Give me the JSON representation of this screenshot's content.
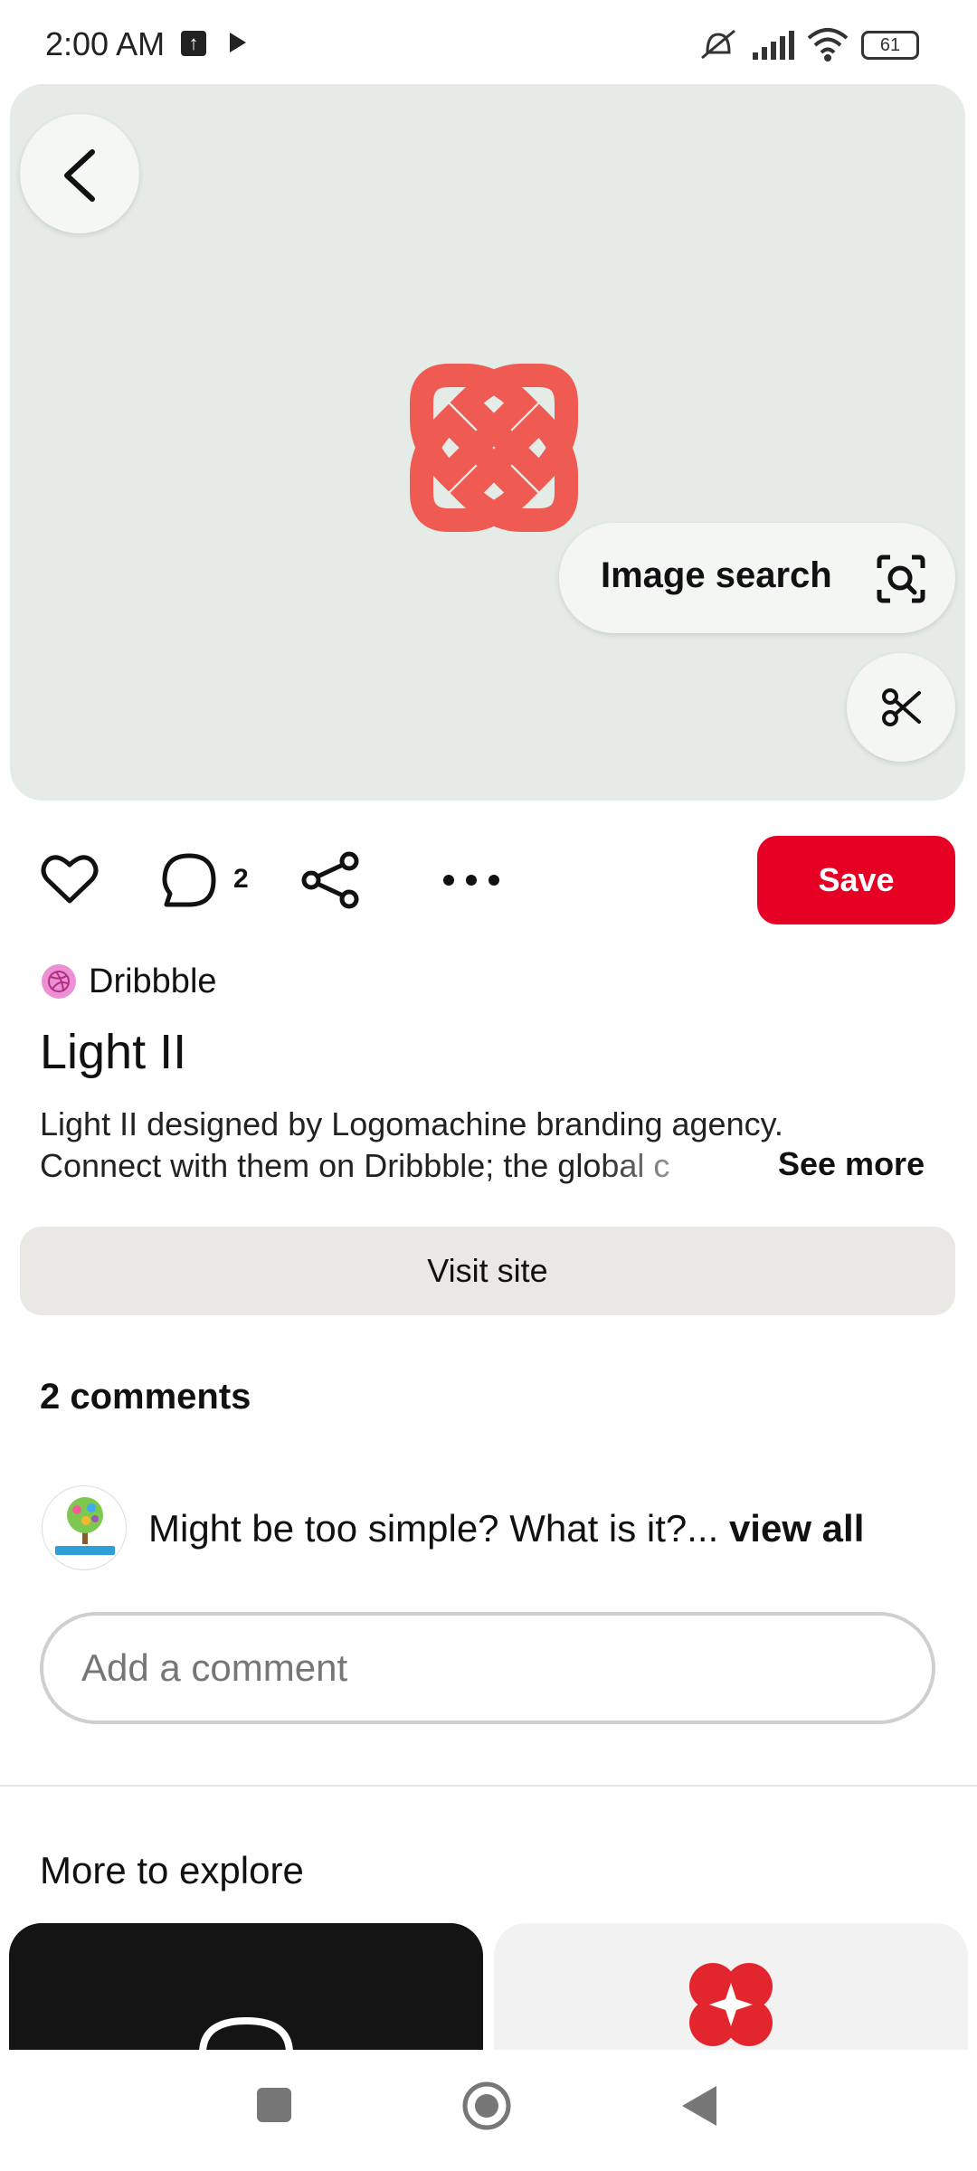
{
  "status_bar": {
    "time": "2:00 AM",
    "battery": "61"
  },
  "pin": {
    "image_search_label": "Image search",
    "comment_count": "2",
    "save_label": "Save",
    "source": "Dribbble",
    "title": "Light II",
    "description_line1": "Light II designed by Logomachine branding agency.",
    "description_line2": "Connect with them on Dribbble; the global c",
    "see_more_label": "See more",
    "visit_site_label": "Visit site"
  },
  "comments": {
    "heading": "2 comments",
    "preview_text": "Might be too simple?  What is it?...",
    "view_all_label": "view all",
    "input_placeholder": "Add a comment"
  },
  "explore": {
    "heading": "More to explore"
  },
  "colors": {
    "save_red": "#e60023",
    "logo_coral": "#ef5b52",
    "hero_bg": "#e5ebe7"
  }
}
